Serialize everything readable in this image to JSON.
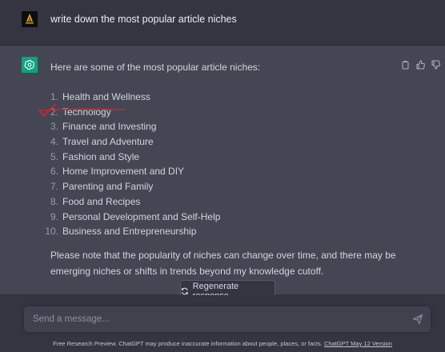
{
  "user_message": {
    "text": "write down the most popular article niches"
  },
  "assistant_message": {
    "intro": "Here are some of the most popular article niches:",
    "list": [
      {
        "num": "1.",
        "text": "Health and Wellness"
      },
      {
        "num": "2.",
        "text": "Technology"
      },
      {
        "num": "3.",
        "text": "Finance and Investing"
      },
      {
        "num": "4.",
        "text": "Travel and Adventure"
      },
      {
        "num": "5.",
        "text": "Fashion and Style"
      },
      {
        "num": "6.",
        "text": "Home Improvement and DIY"
      },
      {
        "num": "7.",
        "text": "Parenting and Family"
      },
      {
        "num": "8.",
        "text": "Food and Recipes"
      },
      {
        "num": "9.",
        "text": "Personal Development and Self-Help"
      },
      {
        "num": "10.",
        "text": "Business and Entrepreneurship"
      }
    ],
    "outro": "Please note that the popularity of niches can change over time, and there may be emerging niches or shifts in trends beyond my knowledge cutoff.",
    "actions": [
      "copy-icon",
      "thumbs-up-icon",
      "thumbs-down-icon"
    ]
  },
  "regenerate": {
    "label": "Regenerate response",
    "icon": "refresh-icon"
  },
  "composer": {
    "placeholder": "Send a message...",
    "send_icon": "send-icon"
  },
  "footer": {
    "text": "Free Research Preview. ChatGPT may produce inaccurate information about people, places, or facts.",
    "link": "ChatGPT May 12 Version"
  },
  "colors": {
    "background": "#343541",
    "assistant_background": "#444654",
    "bot_avatar": "#10a37f",
    "annotation_mark": "#d0252d",
    "input_background": "#40414f"
  }
}
